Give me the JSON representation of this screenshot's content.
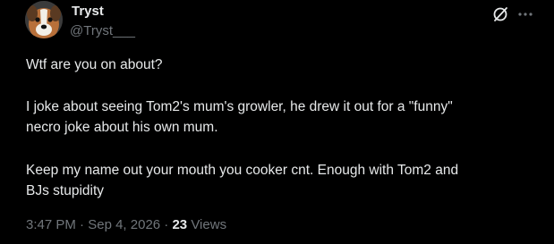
{
  "author": {
    "display_name": "Tryst",
    "handle": "@Tryst___"
  },
  "header_icons": [
    "grok-icon",
    "more-options-icon"
  ],
  "post": {
    "lines": [
      "Wtf are you on about?",
      "I joke about seeing Tom2's mum's growler, he drew it out for a \"funny\"",
      "necro joke about his own mum.",
      "Keep my name out your mouth you cooker cnt. Enough with Tom2 and",
      "BJs stupidity"
    ]
  },
  "meta": {
    "time": "3:47 PM",
    "separator": "·",
    "date": "Sep 4, 2026",
    "views_count": "23",
    "views_label": "Views"
  }
}
